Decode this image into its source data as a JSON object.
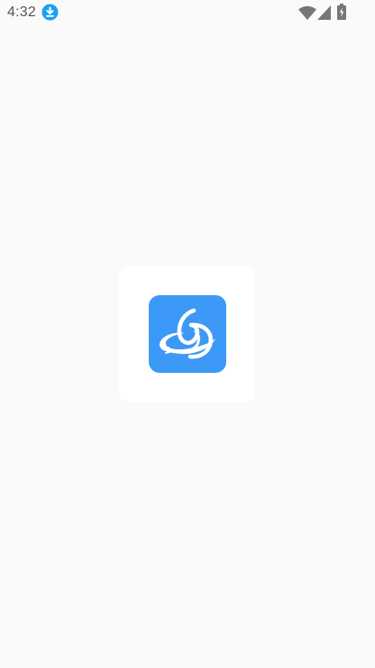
{
  "status_bar": {
    "time": "4:32",
    "notification_icon": "download-icon",
    "icons": [
      "wifi-icon",
      "signal-icon",
      "battery-icon"
    ],
    "download_color": "#1aa0f0"
  },
  "splash": {
    "logo_icon": "app-logo-icon",
    "logo_color": "#3d99f7",
    "card_color": "#ffffff",
    "background": "#fafafa"
  }
}
